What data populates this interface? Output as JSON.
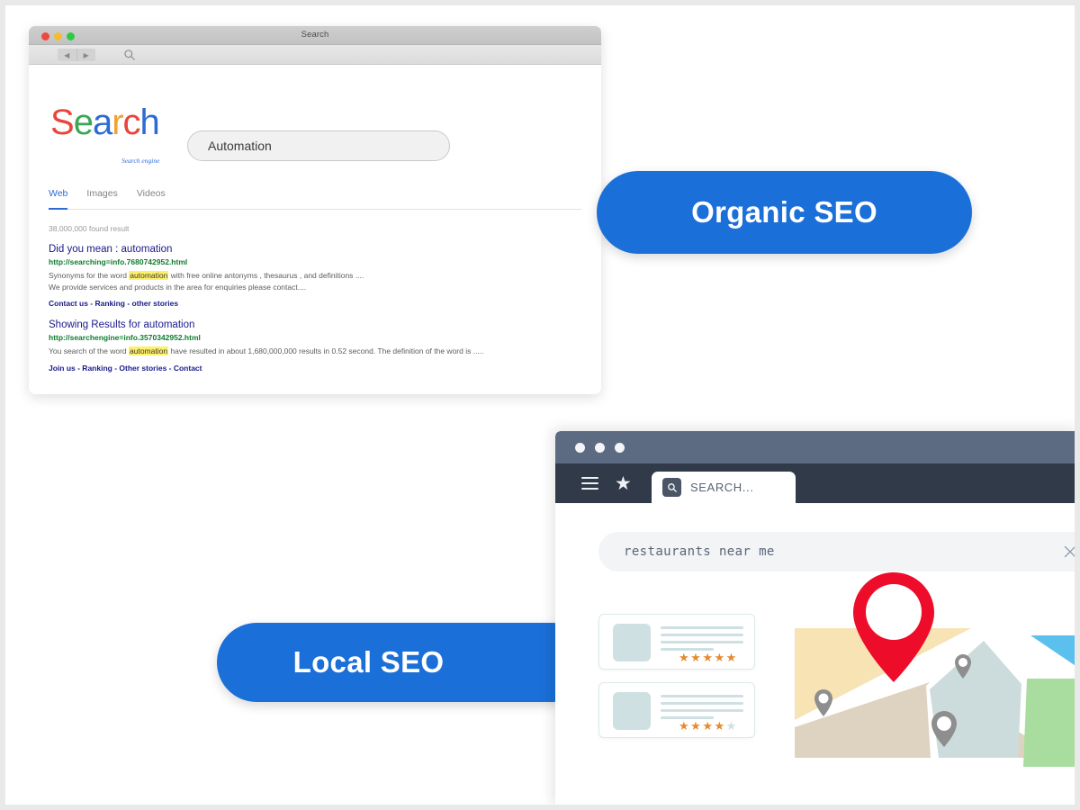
{
  "mac_window": {
    "title": "Search",
    "traffic_lights": [
      "close-red",
      "minimize-yellow",
      "maximize-green"
    ],
    "toolbar": {
      "back_icon": "◀",
      "forward_icon": "▶",
      "search_icon": "search-icon"
    },
    "logo": {
      "letters": [
        {
          "char": "S",
          "color": "#e8453c"
        },
        {
          "char": "e",
          "color": "#3aa757"
        },
        {
          "char": "a",
          "color": "#2d6bd4"
        },
        {
          "char": "r",
          "color": "#f0a32e"
        },
        {
          "char": "c",
          "color": "#e8453c"
        },
        {
          "char": "h",
          "color": "#2d6bd4"
        }
      ],
      "tagline": "Search engine"
    },
    "search": {
      "value": "Automation",
      "placeholder": "Search"
    },
    "tabs": [
      {
        "label": "Web",
        "active": true
      },
      {
        "label": "Images",
        "active": false
      },
      {
        "label": "Videos",
        "active": false
      }
    ],
    "found_count": "38,000,000 found result",
    "results": [
      {
        "title": "Did you mean : automation",
        "url": "http://searching=info.7680742952.html",
        "snippet_pre": "Synonyms for the word ",
        "highlight": "automation",
        "snippet_post": " with free online antonyms , thesaurus , and definitions ....",
        "snippet_line2": "We provide services and products in the area for enquiries please contact....",
        "links": "Contact us - Ranking - other stories"
      },
      {
        "title": "Showing Results for automation",
        "url": "http://searchengine=info.3570342952.html",
        "snippet_pre": "You search of the word ",
        "highlight": "automation",
        "snippet_post": " have resulted in about 1,680,000,000 results in 0.52 second. The definition of the word is .....",
        "snippet_line2": "",
        "links": "Join us - Ranking - Other stories - Contact"
      }
    ]
  },
  "callouts": {
    "organic": {
      "label": "Organic SEO",
      "color": "#1b6fd8",
      "text_color": "#ffffff"
    },
    "local": {
      "label": "Local SEO",
      "color": "#1b6fd8",
      "text_color": "#ffffff"
    }
  },
  "flat_window": {
    "titlebar_color": "#5d6b82",
    "toolbar_color": "#303a49",
    "traffic_lights": [
      "window-dot-1",
      "window-dot-2",
      "window-dot-3"
    ],
    "toolbar": {
      "menu_icon": "hamburger-icon",
      "bookmark_icon": "star-icon",
      "tab_icon": "search-icon",
      "tab_label": "SEARCH..."
    },
    "query": {
      "value": "restaurants near me",
      "placeholder": "Search",
      "clear_icon": "close-icon"
    },
    "result_cards": [
      {
        "rating": 5,
        "max_rating": 5
      },
      {
        "rating": 4,
        "max_rating": 5
      }
    ],
    "map": {
      "pin_color": "#ed0d2b",
      "marker_count": 3,
      "region_colors": {
        "sand": "#f7e3b4",
        "beige": "#ded3c0",
        "teal": "#ccdcdd",
        "green": "#a8dd9f",
        "blue": "#5cc0ef"
      }
    }
  }
}
